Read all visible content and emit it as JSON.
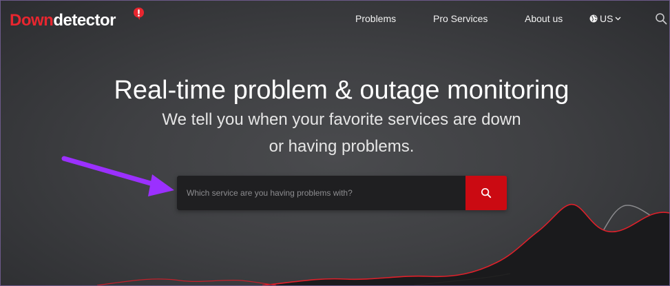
{
  "header": {
    "logo": {
      "part1": "Down",
      "part2": "detector"
    },
    "nav": [
      {
        "label": "Problems"
      },
      {
        "label": "Pro Services"
      },
      {
        "label": "About us"
      }
    ],
    "locale": {
      "label": "US",
      "icon": "globe-icon"
    },
    "search_icon": "search-icon"
  },
  "hero": {
    "title": "Real-time problem & outage monitoring",
    "subtitle_line1": "We tell you when your favorite services are down",
    "subtitle_line2": "or having problems."
  },
  "search": {
    "placeholder": "Which service are you having problems with?",
    "value": "",
    "button_icon": "search-icon"
  },
  "colors": {
    "brand_red": "#e8262f",
    "button_red": "#cb0a12",
    "annotation_arrow": "#9b30ff"
  }
}
